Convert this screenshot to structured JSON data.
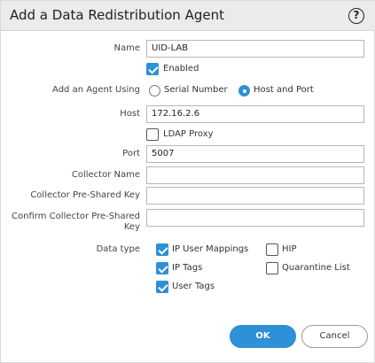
{
  "dialog": {
    "title": "Add a Data Redistribution Agent",
    "help_icon": "?"
  },
  "form": {
    "name": {
      "label": "Name",
      "value": "UID-LAB"
    },
    "enabled": {
      "label": "Enabled",
      "checked": true
    },
    "agent_using": {
      "label": "Add an Agent Using",
      "options": [
        {
          "label": "Serial Number",
          "selected": false
        },
        {
          "label": "Host and Port",
          "selected": true
        }
      ]
    },
    "host": {
      "label": "Host",
      "value": "172.16.2.6"
    },
    "ldap_proxy": {
      "label": "LDAP Proxy",
      "checked": false
    },
    "port": {
      "label": "Port",
      "value": "5007"
    },
    "collector_name": {
      "label": "Collector Name",
      "value": ""
    },
    "collector_psk": {
      "label": "Collector Pre-Shared Key",
      "value": ""
    },
    "confirm_psk": {
      "label_line1": "Confirm Collector Pre-Shared",
      "label_line2": "Key",
      "value": ""
    },
    "data_type": {
      "label": "Data type",
      "items": [
        {
          "label": "IP User Mappings",
          "checked": true
        },
        {
          "label": "IP Tags",
          "checked": true
        },
        {
          "label": "User Tags",
          "checked": true
        },
        {
          "label": "HIP",
          "checked": false
        },
        {
          "label": "Quarantine List",
          "checked": false
        }
      ]
    }
  },
  "buttons": {
    "ok": "OK",
    "cancel": "Cancel"
  },
  "colors": {
    "accent": "#2e90d6",
    "titlebar": "#ebebeb"
  }
}
